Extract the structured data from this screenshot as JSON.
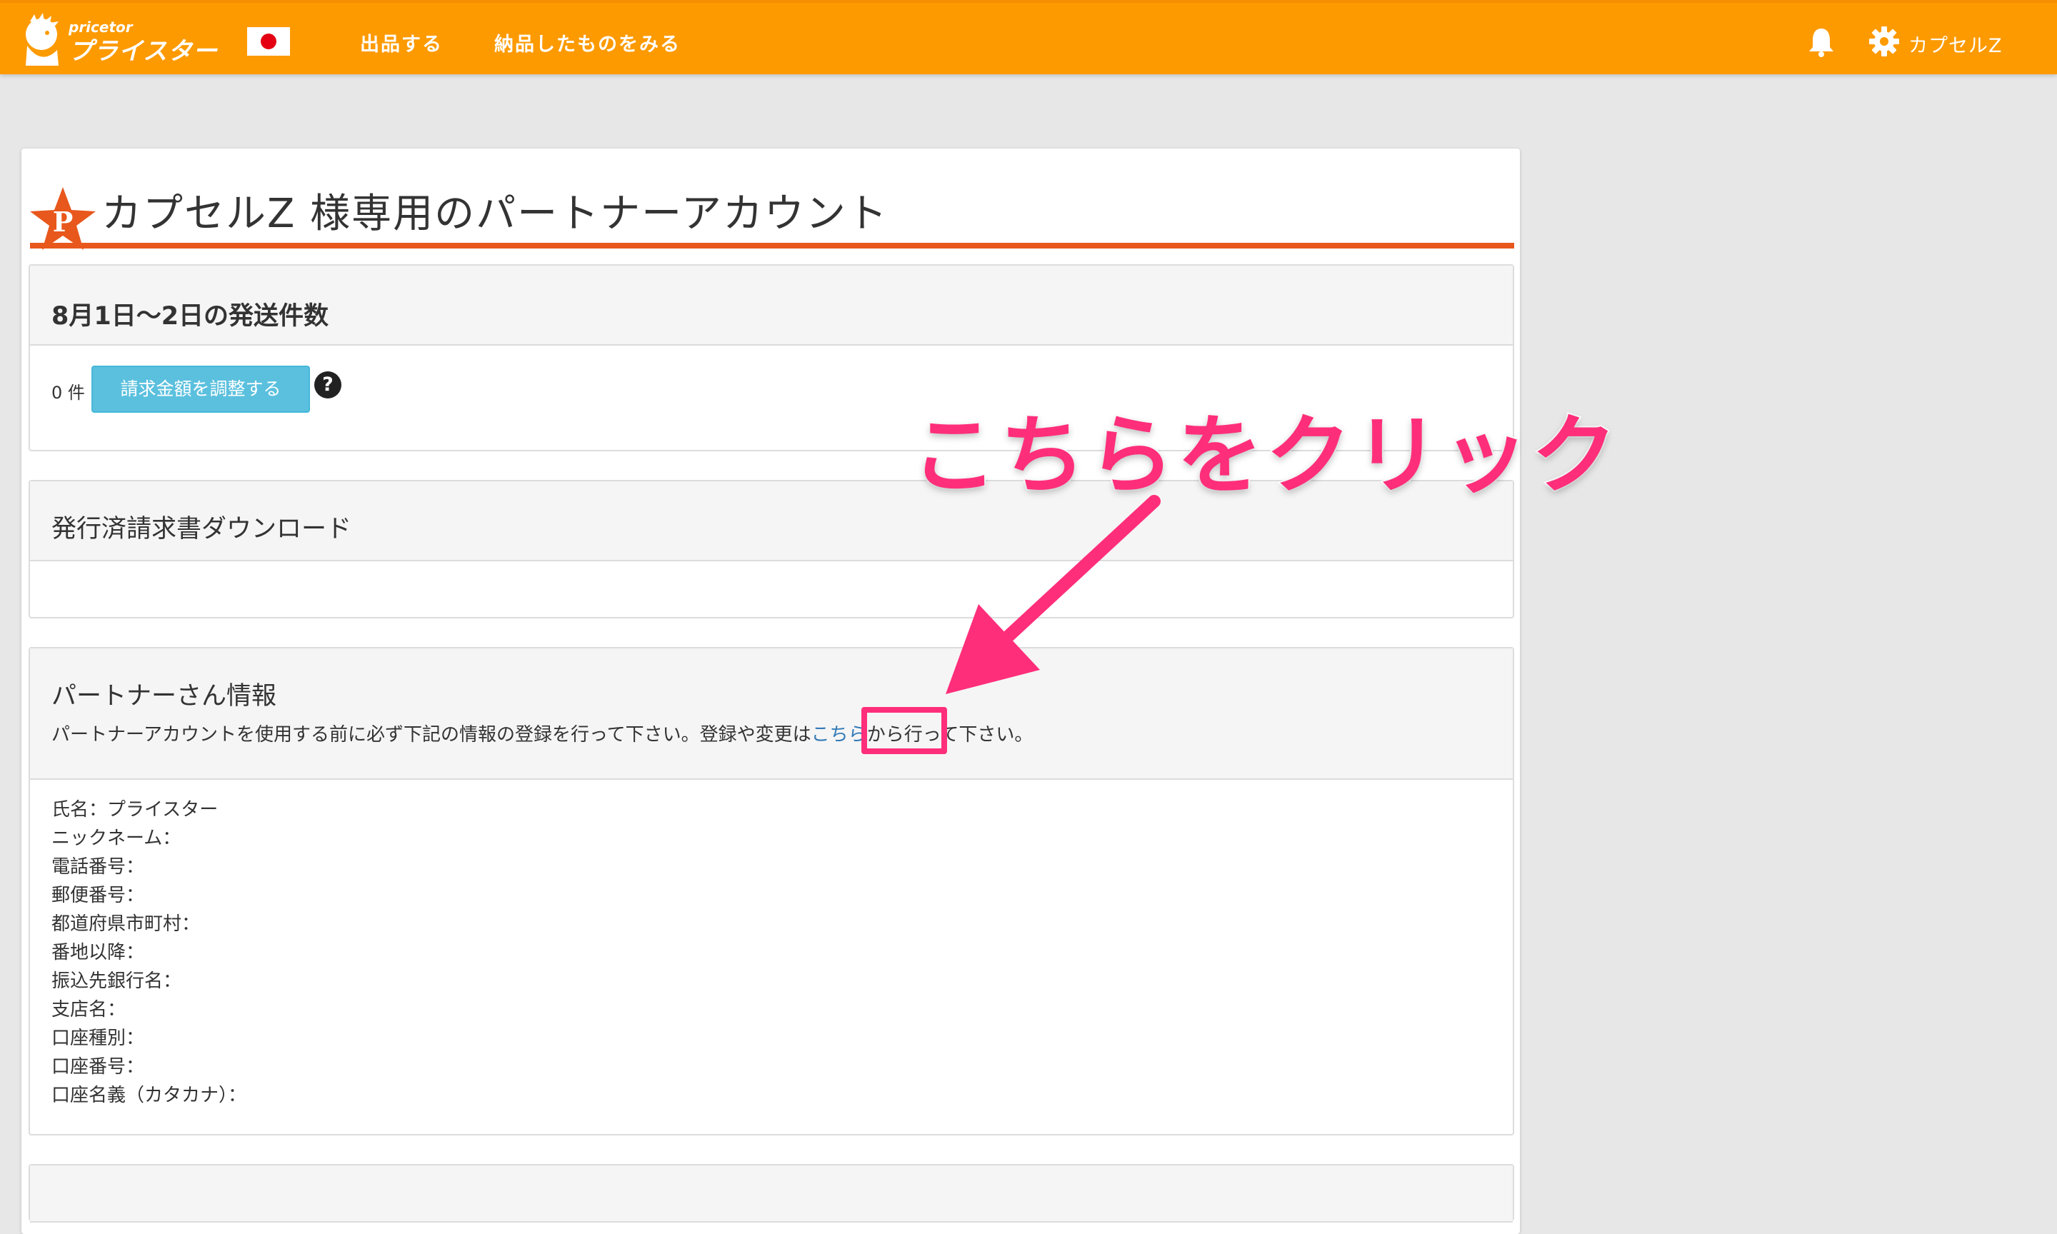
{
  "header": {
    "logo_sub": "pricetor",
    "logo_main": "プライスター",
    "nav": [
      "出品する",
      "納品したものをみる"
    ],
    "user_name": "カプセルZ",
    "colors": {
      "bar": "#fd9a00",
      "text": "#ffffff"
    },
    "icons": [
      "flag-japan-icon",
      "bell-icon",
      "gear-icon"
    ]
  },
  "page": {
    "title": "カプセルZ 様専用のパートナーアカウント",
    "title_badge_letter": "P",
    "accent_color": "#e8571c"
  },
  "shipments": {
    "heading": "8月1日〜2日の発送件数",
    "count": "0 件",
    "adjust_button": "請求金額を調整する",
    "help_icon": "?"
  },
  "invoices": {
    "heading": "発行済請求書ダウンロード"
  },
  "partner": {
    "heading": "パートナーさん情報",
    "intro_before": "パートナーアカウントを使用する前に必ず下記の情報の登録を行って下さい。登録や変更は",
    "intro_link": "こちら",
    "intro_after": "から行って下さい。",
    "fields": [
      "氏名：プライスター",
      "ニックネーム：",
      "電話番号：",
      "郵便番号：",
      "都道府県市町村：",
      "番地以降：",
      "振込先銀行名：",
      "支店名：",
      "口座種別：",
      "口座番号：",
      "口座名義（カタカナ）："
    ]
  },
  "annotation": {
    "callout": "こちらをクリック",
    "color": "#ff2e7a"
  }
}
